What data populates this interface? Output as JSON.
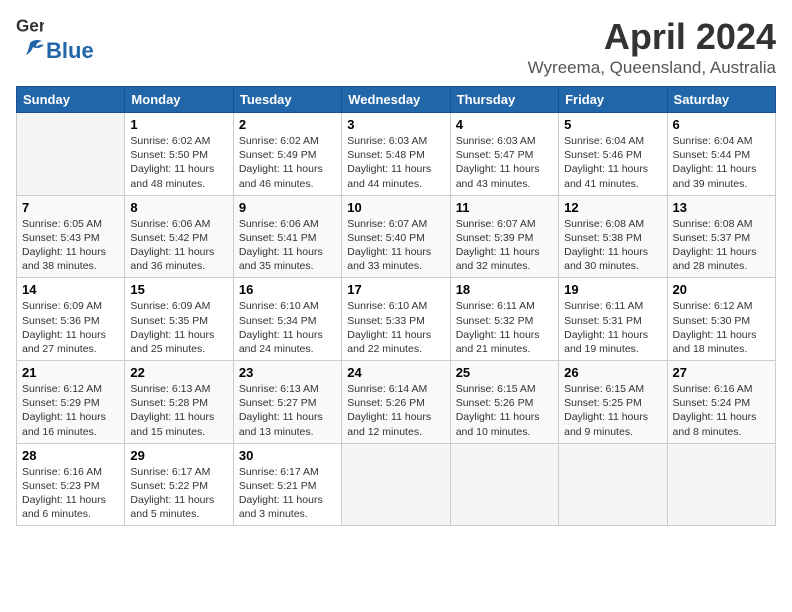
{
  "header": {
    "logo_general": "General",
    "logo_blue": "Blue",
    "month": "April 2024",
    "location": "Wyreema, Queensland, Australia"
  },
  "weekdays": [
    "Sunday",
    "Monday",
    "Tuesday",
    "Wednesday",
    "Thursday",
    "Friday",
    "Saturday"
  ],
  "weeks": [
    [
      {
        "day": "",
        "info": ""
      },
      {
        "day": "1",
        "info": "Sunrise: 6:02 AM\nSunset: 5:50 PM\nDaylight: 11 hours\nand 48 minutes."
      },
      {
        "day": "2",
        "info": "Sunrise: 6:02 AM\nSunset: 5:49 PM\nDaylight: 11 hours\nand 46 minutes."
      },
      {
        "day": "3",
        "info": "Sunrise: 6:03 AM\nSunset: 5:48 PM\nDaylight: 11 hours\nand 44 minutes."
      },
      {
        "day": "4",
        "info": "Sunrise: 6:03 AM\nSunset: 5:47 PM\nDaylight: 11 hours\nand 43 minutes."
      },
      {
        "day": "5",
        "info": "Sunrise: 6:04 AM\nSunset: 5:46 PM\nDaylight: 11 hours\nand 41 minutes."
      },
      {
        "day": "6",
        "info": "Sunrise: 6:04 AM\nSunset: 5:44 PM\nDaylight: 11 hours\nand 39 minutes."
      }
    ],
    [
      {
        "day": "7",
        "info": "Sunrise: 6:05 AM\nSunset: 5:43 PM\nDaylight: 11 hours\nand 38 minutes."
      },
      {
        "day": "8",
        "info": "Sunrise: 6:06 AM\nSunset: 5:42 PM\nDaylight: 11 hours\nand 36 minutes."
      },
      {
        "day": "9",
        "info": "Sunrise: 6:06 AM\nSunset: 5:41 PM\nDaylight: 11 hours\nand 35 minutes."
      },
      {
        "day": "10",
        "info": "Sunrise: 6:07 AM\nSunset: 5:40 PM\nDaylight: 11 hours\nand 33 minutes."
      },
      {
        "day": "11",
        "info": "Sunrise: 6:07 AM\nSunset: 5:39 PM\nDaylight: 11 hours\nand 32 minutes."
      },
      {
        "day": "12",
        "info": "Sunrise: 6:08 AM\nSunset: 5:38 PM\nDaylight: 11 hours\nand 30 minutes."
      },
      {
        "day": "13",
        "info": "Sunrise: 6:08 AM\nSunset: 5:37 PM\nDaylight: 11 hours\nand 28 minutes."
      }
    ],
    [
      {
        "day": "14",
        "info": "Sunrise: 6:09 AM\nSunset: 5:36 PM\nDaylight: 11 hours\nand 27 minutes."
      },
      {
        "day": "15",
        "info": "Sunrise: 6:09 AM\nSunset: 5:35 PM\nDaylight: 11 hours\nand 25 minutes."
      },
      {
        "day": "16",
        "info": "Sunrise: 6:10 AM\nSunset: 5:34 PM\nDaylight: 11 hours\nand 24 minutes."
      },
      {
        "day": "17",
        "info": "Sunrise: 6:10 AM\nSunset: 5:33 PM\nDaylight: 11 hours\nand 22 minutes."
      },
      {
        "day": "18",
        "info": "Sunrise: 6:11 AM\nSunset: 5:32 PM\nDaylight: 11 hours\nand 21 minutes."
      },
      {
        "day": "19",
        "info": "Sunrise: 6:11 AM\nSunset: 5:31 PM\nDaylight: 11 hours\nand 19 minutes."
      },
      {
        "day": "20",
        "info": "Sunrise: 6:12 AM\nSunset: 5:30 PM\nDaylight: 11 hours\nand 18 minutes."
      }
    ],
    [
      {
        "day": "21",
        "info": "Sunrise: 6:12 AM\nSunset: 5:29 PM\nDaylight: 11 hours\nand 16 minutes."
      },
      {
        "day": "22",
        "info": "Sunrise: 6:13 AM\nSunset: 5:28 PM\nDaylight: 11 hours\nand 15 minutes."
      },
      {
        "day": "23",
        "info": "Sunrise: 6:13 AM\nSunset: 5:27 PM\nDaylight: 11 hours\nand 13 minutes."
      },
      {
        "day": "24",
        "info": "Sunrise: 6:14 AM\nSunset: 5:26 PM\nDaylight: 11 hours\nand 12 minutes."
      },
      {
        "day": "25",
        "info": "Sunrise: 6:15 AM\nSunset: 5:26 PM\nDaylight: 11 hours\nand 10 minutes."
      },
      {
        "day": "26",
        "info": "Sunrise: 6:15 AM\nSunset: 5:25 PM\nDaylight: 11 hours\nand 9 minutes."
      },
      {
        "day": "27",
        "info": "Sunrise: 6:16 AM\nSunset: 5:24 PM\nDaylight: 11 hours\nand 8 minutes."
      }
    ],
    [
      {
        "day": "28",
        "info": "Sunrise: 6:16 AM\nSunset: 5:23 PM\nDaylight: 11 hours\nand 6 minutes."
      },
      {
        "day": "29",
        "info": "Sunrise: 6:17 AM\nSunset: 5:22 PM\nDaylight: 11 hours\nand 5 minutes."
      },
      {
        "day": "30",
        "info": "Sunrise: 6:17 AM\nSunset: 5:21 PM\nDaylight: 11 hours\nand 3 minutes."
      },
      {
        "day": "",
        "info": ""
      },
      {
        "day": "",
        "info": ""
      },
      {
        "day": "",
        "info": ""
      },
      {
        "day": "",
        "info": ""
      }
    ]
  ]
}
